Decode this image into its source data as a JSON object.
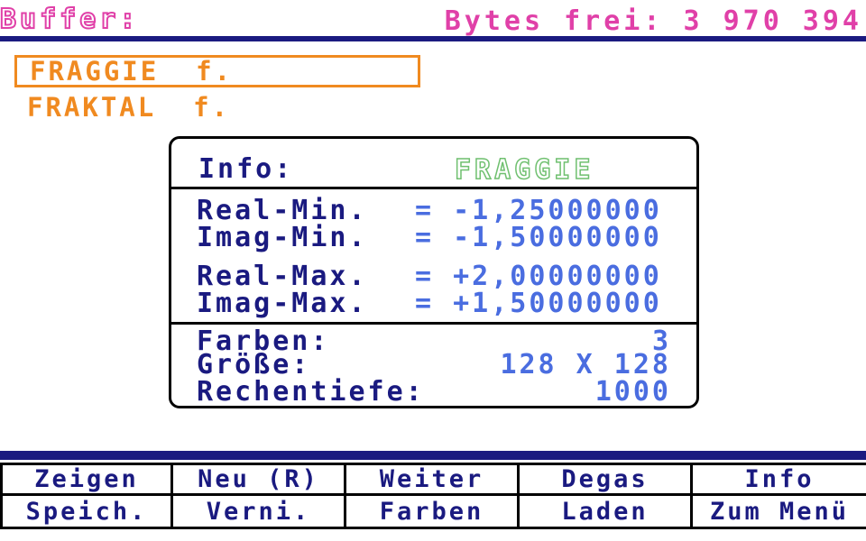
{
  "header": {
    "title": "Buffer:",
    "bytes_free": "Bytes frei: 3 970 394"
  },
  "list": {
    "items": [
      {
        "label": "FRAGGIE  f.",
        "selected": true
      },
      {
        "label": "FRAKTAL  f.",
        "selected": false
      }
    ]
  },
  "info": {
    "label": "Info:",
    "name": "FRAGGIE",
    "real_min_label": "Real-Min.",
    "real_min_value": "= -1,25000000",
    "imag_min_label": "Imag-Min.",
    "imag_min_value": "= -1,50000000",
    "real_max_label": "Real-Max.",
    "real_max_value": "= +2,00000000",
    "imag_max_label": "Imag-Max.",
    "imag_max_value": "= +1,50000000",
    "colors_label": "Farben:",
    "colors_value": "3",
    "size_label": "Größe:",
    "size_value": "128 X 128",
    "depth_label": "Rechentiefe:",
    "depth_value": "1000"
  },
  "menu": {
    "row1": [
      "Zeigen",
      "Neu (R)",
      "Weiter",
      "Degas",
      "Info"
    ],
    "row2": [
      "Speich.",
      "Verni.",
      "Farben",
      "Laden",
      "Zum Menü"
    ]
  },
  "colors": {
    "title": "#e040a8",
    "navy": "#1a1a80",
    "orange": "#f08a20",
    "value_blue": "#4a6de0",
    "name_green": "#70c070"
  }
}
